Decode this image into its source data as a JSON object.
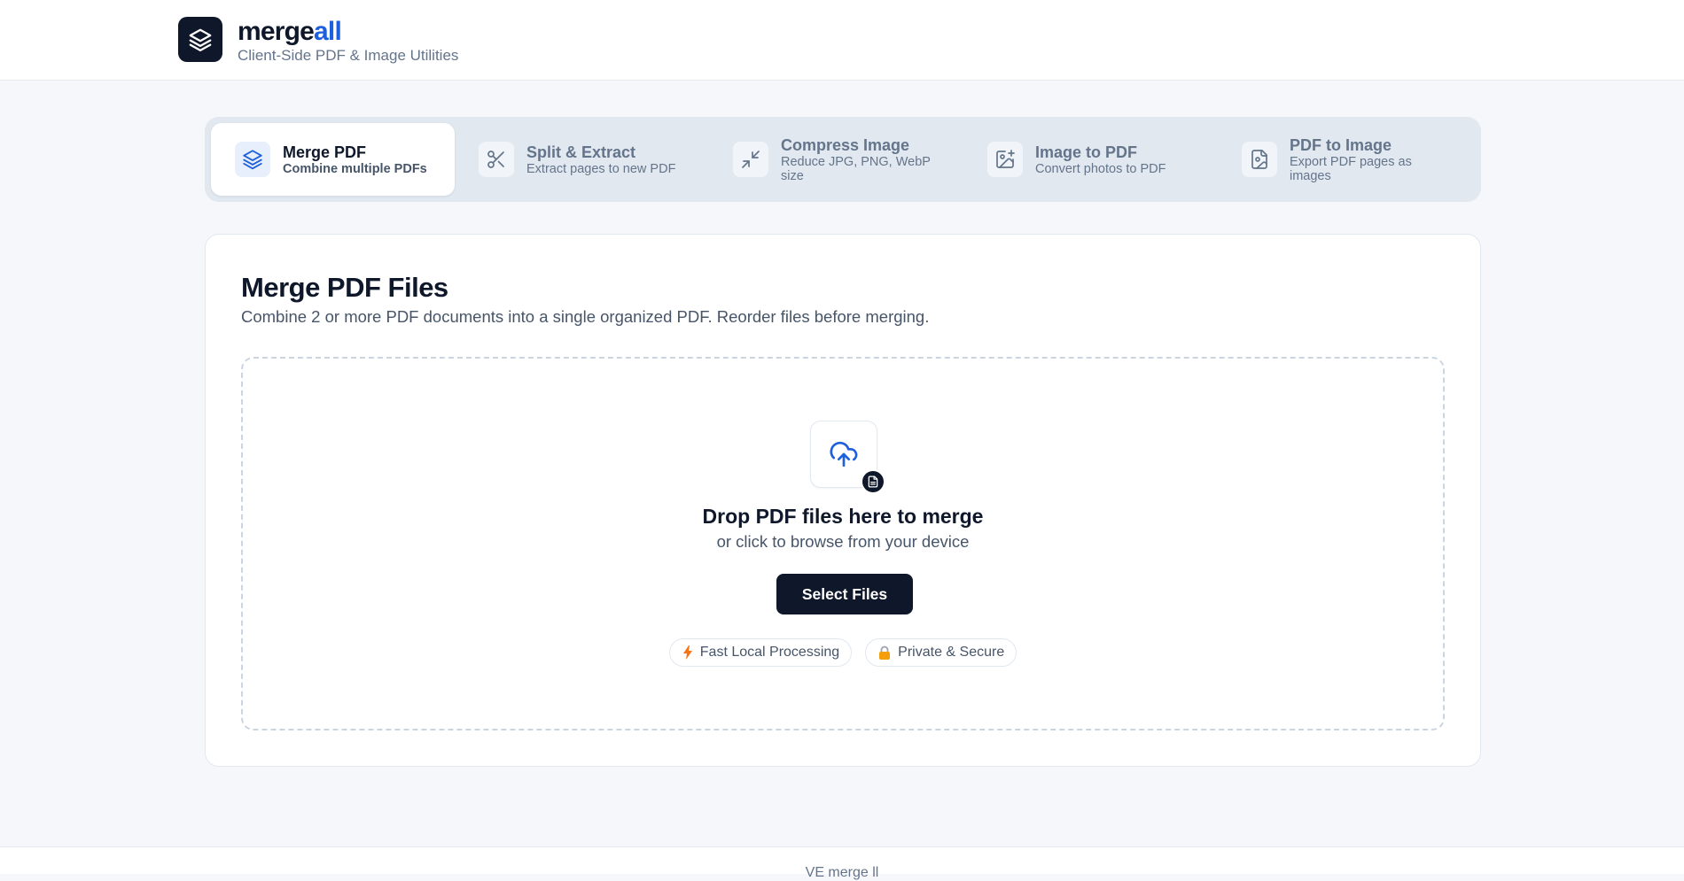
{
  "brand": {
    "name_main": "merge",
    "name_accent": "all",
    "tagline": "Client-Side PDF & Image Utilities",
    "accent_color": "#1d5fdc"
  },
  "tabs": [
    {
      "title": "Merge PDF",
      "subtitle": "Combine multiple PDFs",
      "icon": "layers-icon",
      "active": true
    },
    {
      "title": "Split & Extract",
      "subtitle": "Extract pages to new PDF",
      "icon": "scissors-icon",
      "active": false
    },
    {
      "title": "Compress Image",
      "subtitle": "Reduce JPG, PNG, WebP size",
      "icon": "minimize-icon",
      "active": false
    },
    {
      "title": "Image to PDF",
      "subtitle": "Convert photos to PDF",
      "icon": "image-plus-icon",
      "active": false
    },
    {
      "title": "PDF to Image",
      "subtitle": "Export PDF pages as images",
      "icon": "file-image-icon",
      "active": false
    }
  ],
  "main": {
    "title": "Merge PDF Files",
    "description": "Combine 2 or more PDF documents into a single organized PDF. Reorder files before merging.",
    "dropzone": {
      "icon": "cloud-upload-icon",
      "badge_icon": "document-icon",
      "title": "Drop PDF files here to merge",
      "subtitle": "or click to browse from your device",
      "button_label": "Select Files"
    },
    "features": [
      {
        "label": "Fast Local Processing",
        "icon": "lightning-icon"
      },
      {
        "label": "Private & Secure",
        "icon": "lock-icon"
      }
    ]
  },
  "footer": {
    "text": "VE merge ll"
  },
  "colors": {
    "dark": "#0f172a",
    "muted": "#64748b",
    "tab_bar": "#e2e8f0",
    "background": "#f5f7fa"
  }
}
